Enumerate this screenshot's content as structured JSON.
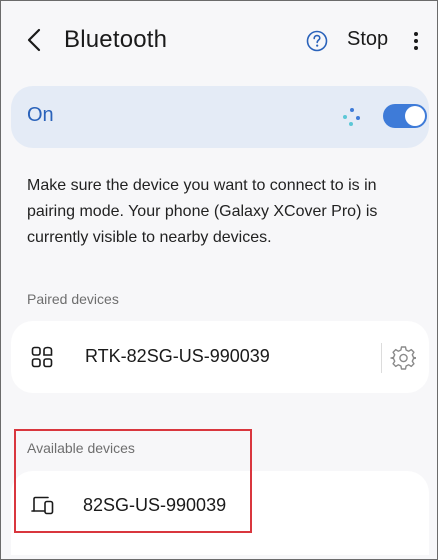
{
  "header": {
    "back_icon": "chevron-left-icon",
    "title": "Bluetooth",
    "help_icon": "help-circle-icon",
    "stop_label": "Stop",
    "more_icon": "more-vertical-icon"
  },
  "bluetooth": {
    "status_label": "On",
    "scan_icon": "scanning-dots-icon",
    "toggle_on": true,
    "accent_color": "#3e7bd8"
  },
  "description": "Make sure the device you want to connect to is in pairing mode. Your phone (Galaxy XCover Pro) is currently visible to nearby devices.",
  "paired": {
    "section_label": "Paired devices",
    "devices": [
      {
        "name": "RTK-82SG-US-990039",
        "icon": "device-grid-icon",
        "settings_icon": "gear-icon"
      }
    ]
  },
  "available": {
    "section_label": "Available devices",
    "devices": [
      {
        "name": "82SG-US-990039",
        "icon": "computer-phone-icon"
      }
    ],
    "highlight_color": "#d9363e"
  }
}
